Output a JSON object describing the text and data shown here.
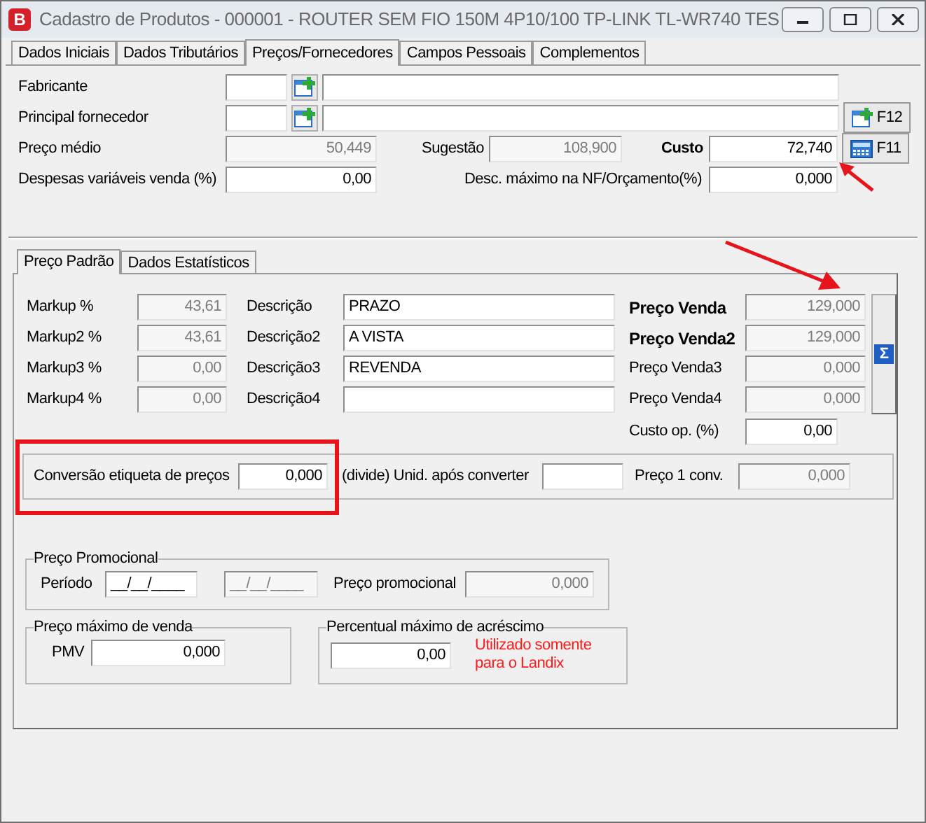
{
  "window": {
    "app_icon": "B",
    "title": "Cadastro de Produtos - 000001 - ROUTER SEM FIO 150M 4P10/100 TP-LINK TL-WR740 TES"
  },
  "tabs": [
    {
      "label": "Dados Iniciais",
      "selected": false
    },
    {
      "label": "Dados Tributários",
      "selected": false
    },
    {
      "label": "Preços/Fornecedores",
      "selected": true
    },
    {
      "label": "Campos Pessoais",
      "selected": false
    },
    {
      "label": "Complementos",
      "selected": false
    }
  ],
  "lookups": [
    {
      "label": "Fabricante"
    },
    {
      "label": "Principal fornecedor",
      "shortcut": "F12"
    }
  ],
  "cost_row": {
    "average": {
      "label": "Preço médio",
      "value": "50,449",
      "disabled": true
    },
    "suggestion": {
      "label": "Sugestão",
      "value": "108,900",
      "disabled": true
    },
    "cost": {
      "label": "Custo",
      "value": "72,740",
      "disabled": false
    },
    "shortcut": "F11"
  },
  "expense_row": {
    "expenses": {
      "label": "Despesas variáveis venda (%)",
      "value": "0,00",
      "disabled": false
    },
    "discount": {
      "label": "Desc. máximo na NF/Orçamento(%)",
      "value": "0,000",
      "disabled": false
    }
  },
  "price_tabs": [
    {
      "label": "Preço Padrão",
      "selected": true
    },
    {
      "label": "Dados Estatísticos",
      "selected": false
    }
  ],
  "price_rows": [
    {
      "markup_label": "Markup %",
      "markup": "43,61",
      "description_label": "Descrição",
      "description": "PRAZO",
      "price_label": "Preço Venda",
      "price": "129,000",
      "emphasized": true
    },
    {
      "markup_label": "Markup2 %",
      "markup": "43,61",
      "description_label": "Descrição2",
      "description": "A VISTA",
      "price_label": "Preço Venda2",
      "price": "129,000",
      "emphasized": true
    },
    {
      "markup_label": "Markup3 %",
      "markup": "0,00",
      "description_label": "Descrição3",
      "description": "REVENDA",
      "price_label": "Preço Venda3",
      "price": "0,000",
      "emphasized": false
    },
    {
      "markup_label": "Markup4 %",
      "markup": "0,00",
      "description_label": "Descrição4",
      "price_label": "Preço Venda4",
      "price": "0,000",
      "emphasized": false
    }
  ],
  "sum_button": {
    "symbol": "Σ"
  },
  "operational_cost": {
    "label": "Custo op. (%)",
    "value": "0,00"
  },
  "conversion": {
    "label": "Conversão etiqueta de preços",
    "value": "0,000",
    "units_label": "(divide) Unid. após converter",
    "price_label": "Preço 1 conv.",
    "price": "0,000"
  },
  "promotion": {
    "title": "Preço Promocional",
    "period_label": "Período",
    "start": {
      "value": "__/__/____",
      "disabled": false
    },
    "end": {
      "value": "__/__/____",
      "disabled": true
    },
    "price_label": "Preço promocional",
    "price": "0,000"
  },
  "max_price": {
    "title": "Preço máximo de venda",
    "label": "PMV",
    "value": "0,000"
  },
  "max_increase": {
    "title": "Percentual máximo de acréscimo",
    "value": "0,00",
    "note": "Utilizado somente para o Landix"
  }
}
